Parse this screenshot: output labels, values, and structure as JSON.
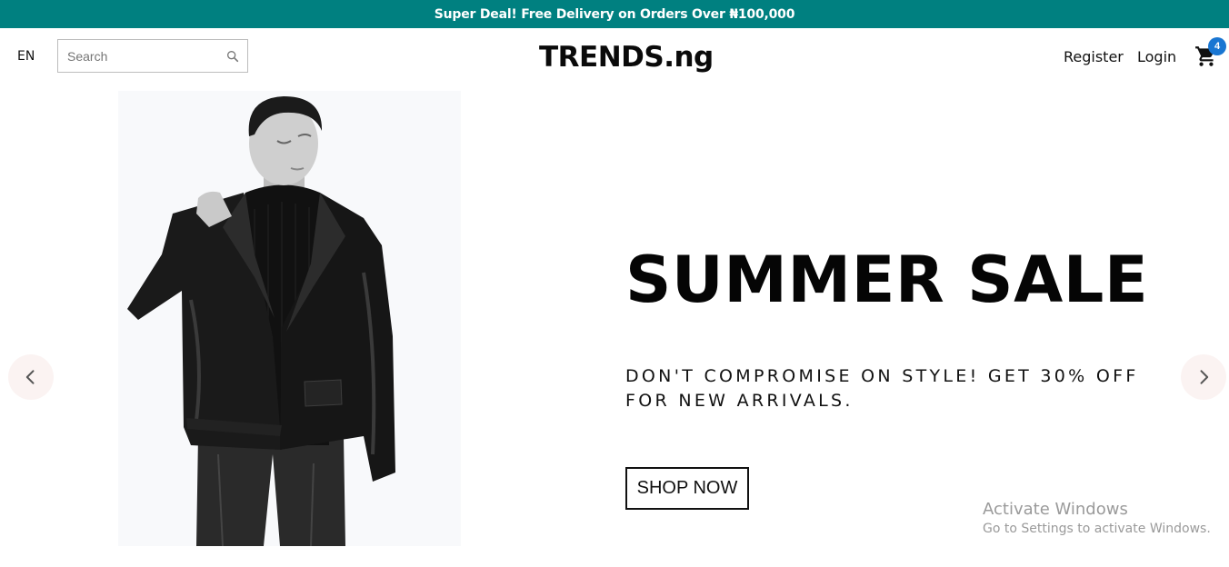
{
  "announcement": "Super Deal! Free Delivery on Orders Over ₦100,000",
  "navbar": {
    "language": "EN",
    "search_placeholder": "Search",
    "logo": "TRENDS.ng",
    "register": "Register",
    "login": "Login",
    "cart_count": "4"
  },
  "slide": {
    "title": "SUMMER SALE",
    "description": "DON'T COMPROMISE ON STYLE! GET 30% OFF FOR NEW ARRIVALS.",
    "button": "SHOP NOW",
    "image_icon": "man-in-leather-jacket-photo",
    "background": "#f8f9fb"
  },
  "watermark": {
    "line1": "Activate Windows",
    "line2": "Go to Settings to activate Windows."
  },
  "colors": {
    "announcement_bg": "#008080",
    "badge": "#1976d2",
    "arrow_bg": "#fbf3f2"
  }
}
